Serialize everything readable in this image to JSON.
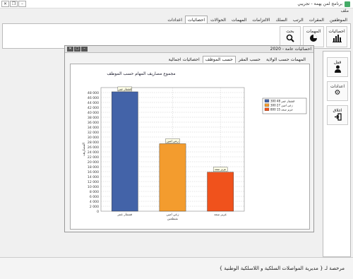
{
  "window": {
    "title": "برنامج لمن يهمة - تجريبي"
  },
  "menubar": {
    "label": "ملف"
  },
  "tabs": [
    "الموظفين",
    "المقرات",
    "الرتب",
    "السلك",
    "الالتزامات",
    "المهمات",
    "الحوالات",
    "احصائيات",
    "اعدادات"
  ],
  "ribbon": {
    "stats_label": "احصائيات",
    "missions_label": "المهمات",
    "search_label": "بحث"
  },
  "side": {
    "lock_label": "قفل",
    "settings_label": "اعدادات",
    "close_label": "اغلاق"
  },
  "inner_window": {
    "title": "احصائيات عامة - 2020"
  },
  "inner_tabs": [
    "المهمات حسب الولاية",
    "حسب المقر",
    "حسب الموظف",
    "احصائيات اجمالية"
  ],
  "chart_data": {
    "type": "bar",
    "title": "مجموع مصاريف المهام حسب الموظف",
    "categories": [
      "قشقار عمر",
      "زعي امين",
      "عزيز سعد"
    ],
    "category_sublabel": "نقيطغين",
    "values": [
      48300,
      27300,
      15800
    ],
    "data_labels": [
      "قشقار عمر",
      "زعي امين",
      "عزيز سعد"
    ],
    "colors": [
      "#4363a8",
      "#f39c2e",
      "#f0521c"
    ],
    "legend": [
      "قشقار عمر 48 300",
      "زعي امين 27 300",
      "عزيز سعد 15 800"
    ],
    "legend_position": "top-right",
    "ylabel": "المصاريف",
    "ylim": [
      0,
      50000
    ],
    "yticks": [
      0,
      2000,
      4000,
      6000,
      8000,
      10000,
      12000,
      14000,
      16000,
      18000,
      20000,
      22000,
      24000,
      26000,
      28000,
      30000,
      32000,
      34000,
      36000,
      38000,
      40000,
      42000,
      44000,
      46000,
      48000
    ],
    "ytick_labels": [
      "0",
      "2 000",
      "4 000",
      "6 000",
      "8 000",
      "10 000",
      "12 000",
      "14 000",
      "16 000",
      "18 000",
      "20 000",
      "22 000",
      "24 000",
      "26 000",
      "28 000",
      "30 000",
      "32 000",
      "34 000",
      "36 000",
      "38 000",
      "40 000",
      "42 000",
      "44 000",
      "46 000",
      "48 000"
    ],
    "grid": true
  },
  "status": {
    "text": "مرخصة لـ { مديرية المواصلات السلكية و اللاسلكية الوطنية }"
  }
}
